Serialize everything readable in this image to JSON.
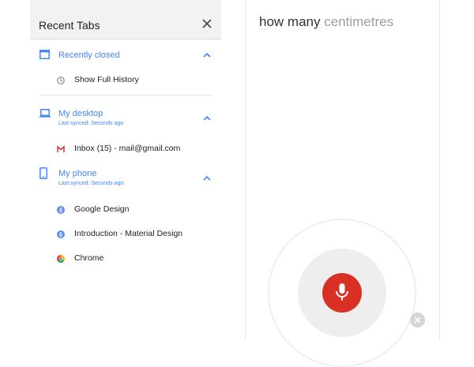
{
  "recent_tabs": {
    "title": "Recent Tabs",
    "close_icon": "close-icon",
    "sections": [
      {
        "name": "Recently closed",
        "icon": "browser-window-icon",
        "items": [
          {
            "label": "Show Full History",
            "icon": "clock-icon"
          }
        ]
      },
      {
        "name": "My desktop",
        "subtitle": "Last synced: Seconds ago",
        "icon": "laptop-icon",
        "items": [
          {
            "label": "Inbox (15) - mail@gmail.com",
            "icon": "gmail-icon"
          }
        ]
      },
      {
        "name": "My phone",
        "subtitle": "Last synced: Seconds ago",
        "icon": "phone-icon",
        "items": [
          {
            "label": "Google Design",
            "icon": "blue-badge-icon"
          },
          {
            "label": "Introduction - Material Design",
            "icon": "blue-badge-icon"
          },
          {
            "label": "Chrome",
            "icon": "chrome-icon"
          }
        ]
      }
    ]
  },
  "voice_search": {
    "query_recognized": "how many",
    "query_pending": "centimetres",
    "mic_icon": "microphone-icon",
    "cancel_icon": "cancel-icon"
  },
  "colors": {
    "accent": "#4285f4",
    "mic_red": "#d93025",
    "header_bg": "#f2f2f2",
    "text": "#212121"
  }
}
